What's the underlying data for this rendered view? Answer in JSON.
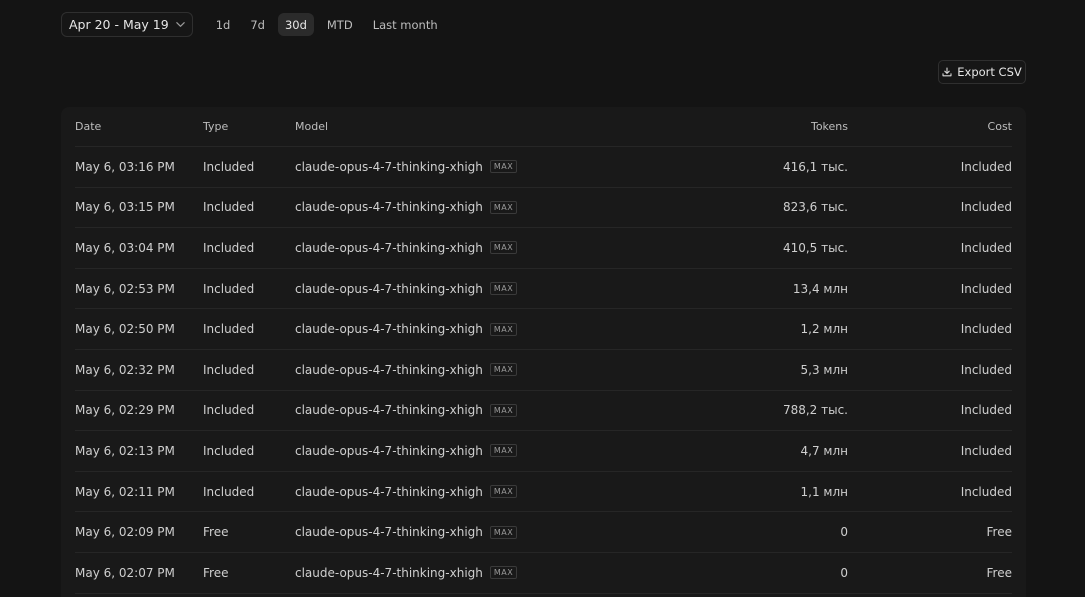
{
  "filters": {
    "date_range": "Apr 20 - May 19",
    "ranges": [
      "1d",
      "7d",
      "30d",
      "MTD",
      "Last month"
    ],
    "active_range": "30d"
  },
  "export": {
    "label": "Export CSV",
    "icon": "download-icon"
  },
  "table": {
    "columns": [
      "Date",
      "Type",
      "Model",
      "Tokens",
      "Cost"
    ],
    "badge_label": "MAX",
    "rows": [
      {
        "date": "May 6, 03:16 PM",
        "type": "Included",
        "model": "claude-opus-4-7-thinking-xhigh",
        "tokens": "416,1 тыс.",
        "cost": "Included"
      },
      {
        "date": "May 6, 03:15 PM",
        "type": "Included",
        "model": "claude-opus-4-7-thinking-xhigh",
        "tokens": "823,6 тыс.",
        "cost": "Included"
      },
      {
        "date": "May 6, 03:04 PM",
        "type": "Included",
        "model": "claude-opus-4-7-thinking-xhigh",
        "tokens": "410,5 тыс.",
        "cost": "Included"
      },
      {
        "date": "May 6, 02:53 PM",
        "type": "Included",
        "model": "claude-opus-4-7-thinking-xhigh",
        "tokens": "13,4 млн",
        "cost": "Included"
      },
      {
        "date": "May 6, 02:50 PM",
        "type": "Included",
        "model": "claude-opus-4-7-thinking-xhigh",
        "tokens": "1,2 млн",
        "cost": "Included"
      },
      {
        "date": "May 6, 02:32 PM",
        "type": "Included",
        "model": "claude-opus-4-7-thinking-xhigh",
        "tokens": "5,3 млн",
        "cost": "Included"
      },
      {
        "date": "May 6, 02:29 PM",
        "type": "Included",
        "model": "claude-opus-4-7-thinking-xhigh",
        "tokens": "788,2 тыс.",
        "cost": "Included"
      },
      {
        "date": "May 6, 02:13 PM",
        "type": "Included",
        "model": "claude-opus-4-7-thinking-xhigh",
        "tokens": "4,7 млн",
        "cost": "Included"
      },
      {
        "date": "May 6, 02:11 PM",
        "type": "Included",
        "model": "claude-opus-4-7-thinking-xhigh",
        "tokens": "1,1 млн",
        "cost": "Included"
      },
      {
        "date": "May 6, 02:09 PM",
        "type": "Free",
        "model": "claude-opus-4-7-thinking-xhigh",
        "tokens": "0",
        "cost": "Free"
      },
      {
        "date": "May 6, 02:07 PM",
        "type": "Free",
        "model": "claude-opus-4-7-thinking-xhigh",
        "tokens": "0",
        "cost": "Free"
      }
    ]
  }
}
